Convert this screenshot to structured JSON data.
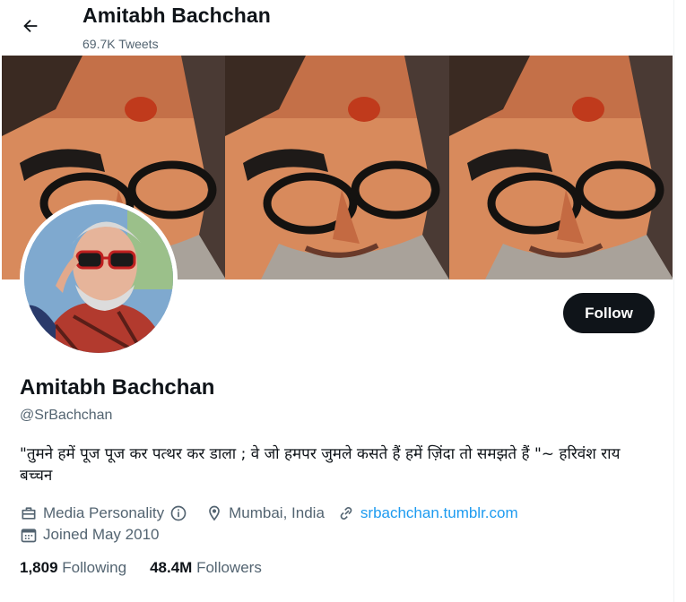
{
  "header": {
    "title": "Amitabh Bachchan",
    "tweet_count": "69.7K Tweets"
  },
  "profile": {
    "name": "Amitabh Bachchan",
    "handle": "@SrBachchan",
    "bio": "\"तुमने हमें पूज पूज कर पत्थर कर डाला ; वे जो हमपर जुमले कसते हैं हमें ज़िंदा तो समझते हैं \"~ हरिवंश राय  बच्चन",
    "category": "Media Personality",
    "location": "Mumbai, India",
    "website": "srbachchan.tumblr.com",
    "joined": "Joined May 2010"
  },
  "actions": {
    "follow_label": "Follow"
  },
  "stats": {
    "following_count": "1,809",
    "following_label": "Following",
    "followers_count": "48.4M",
    "followers_label": "Followers"
  },
  "icons": {
    "back": "arrow-left-icon",
    "category": "briefcase-icon",
    "info": "info-icon",
    "location": "map-pin-icon",
    "website": "link-icon",
    "joined": "calendar-icon"
  },
  "colors": {
    "text": "#0f1419",
    "secondary": "#536471",
    "link": "#1d9bf0",
    "follow_bg": "#0f1419"
  }
}
